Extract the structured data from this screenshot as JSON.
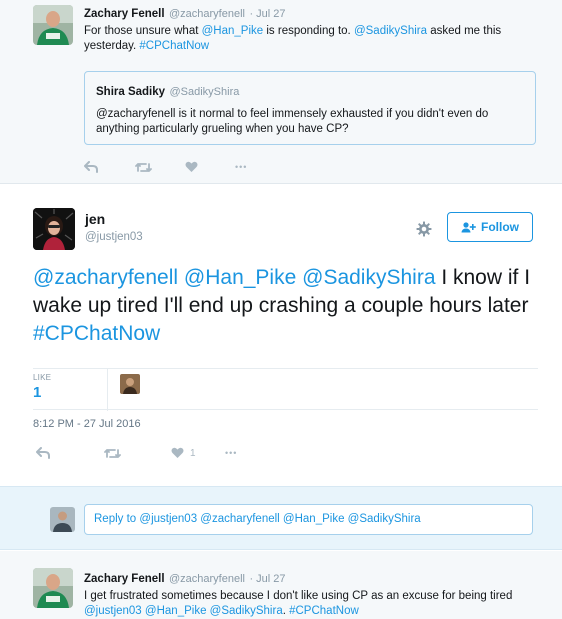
{
  "context_tweet": {
    "name": "Zachary Fenell",
    "handle": "@zacharyfenell",
    "time": "Jul 27",
    "text_1": "For those unsure what ",
    "mention_1": "@Han_Pike",
    "text_2": " is responding to. ",
    "mention_2": "@SadikyShira",
    "text_3": " asked me this yesterday. ",
    "hashtag": "#CPChatNow",
    "quote": {
      "name": "Shira Sadiky",
      "handle": "@SadikyShira",
      "text": "@zacharyfenell is it normal to feel immensely exhausted if you didn't even do anything particularly grueling when you have CP?"
    },
    "actions": {
      "more": "•••"
    }
  },
  "main_tweet": {
    "name": "jen",
    "handle": "@justjen03",
    "follow_label": "Follow",
    "mention_1": "@zacharyfenell",
    "mention_2": "@Han_Pike",
    "mention_3": "@SadikyShira",
    "text": " I know if I wake up tired I'll end up crashing a couple hours later ",
    "hashtag": "#CPChatNow",
    "likes_label": "LIKE",
    "likes_count": "1",
    "timestamp": "8:12 PM - 27 Jul 2016",
    "action_like_count": "1",
    "actions": {
      "more": "•••"
    }
  },
  "reply_box": {
    "prefix": "Reply to ",
    "mentions": "@justjen03 @zacharyfenell @Han_Pike @SadikyShira"
  },
  "bottom_tweet": {
    "name": "Zachary Fenell",
    "handle": "@zacharyfenell",
    "time": "Jul 27",
    "text_1": "I get frustrated sometimes because I don't like using CP as an excuse for being tired ",
    "mention_1": "@justjen03",
    "mention_2": "@Han_Pike",
    "mention_3": "@SadikyShira",
    "hashtag": "#CPChatNow"
  },
  "colors": {
    "link": "#1b95e0",
    "icon_gray": "#aab8c2",
    "context_bg": "#f5f8fa",
    "reply_bg": "#e8f4fb"
  }
}
